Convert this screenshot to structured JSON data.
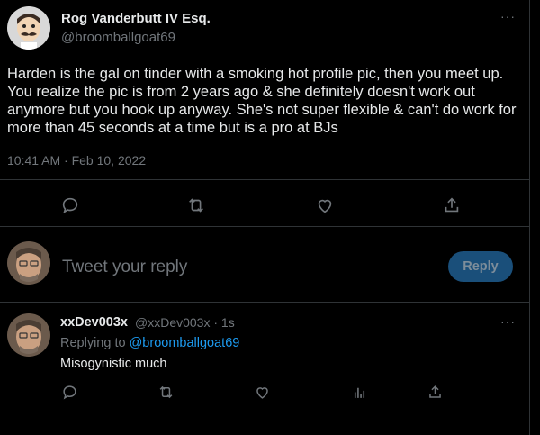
{
  "tweet": {
    "author_name": "Rog Vanderbutt IV Esq.",
    "author_handle": "@broomballgoat69",
    "text": "Harden is the gal on tinder with a smoking hot profile pic, then you meet up. You realize the pic is from 2 years ago & she definitely doesn't work out anymore but you hook up anyway. She's not super flexible & can't do work for more than 45 seconds at a time but is a pro at BJs",
    "timestamp": "10:41 AM · Feb 10, 2022",
    "more_icon": "···",
    "actions": [
      "reply-icon",
      "retweet-icon",
      "like-icon",
      "share-icon"
    ]
  },
  "composer": {
    "placeholder": "Tweet your reply",
    "button_label": "Reply"
  },
  "reply": {
    "author_name": "xxDev003x",
    "meta": "@xxDev003x · 1s",
    "replying_prefix": "Replying to ",
    "replying_to": "@broomballgoat69",
    "text": "Misogynistic much",
    "more_icon": "···",
    "actions": [
      "reply-icon",
      "retweet-icon",
      "like-icon",
      "analytics-icon",
      "share-icon"
    ]
  },
  "colors": {
    "background": "#000000",
    "divider": "#2f3336",
    "muted": "#71767b",
    "link": "#1d9bf0",
    "reply_button": "#1a4f7a"
  }
}
